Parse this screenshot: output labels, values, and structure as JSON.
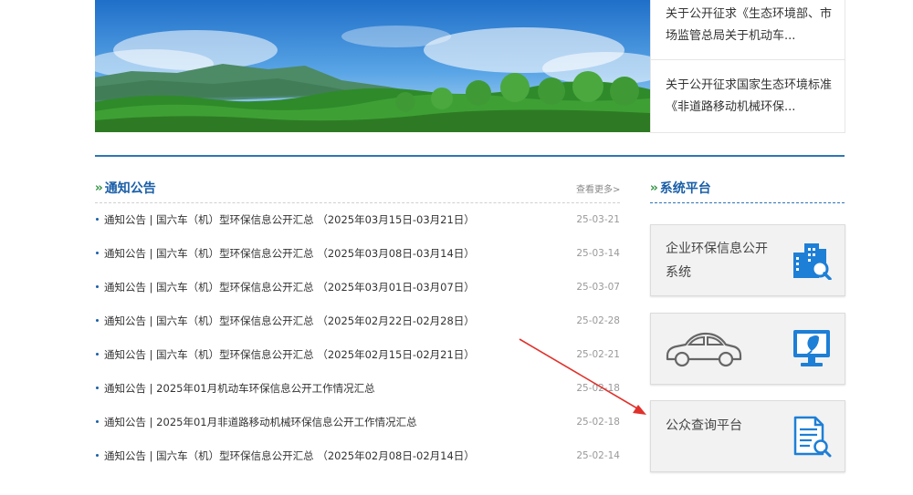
{
  "banner": {
    "news": [
      {
        "text": "关于公开征求《生态环境部、市场监管总局关于机动车..."
      },
      {
        "text": "关于公开征求国家生态环境标准《非道路移动机械环保..."
      }
    ]
  },
  "notice": {
    "title": "通知公告",
    "more": "查看更多>",
    "items": [
      {
        "title": "通知公告 | 国六车（机）型环保信息公开汇总 （2025年03月15日-03月21日）",
        "date": "25-03-21"
      },
      {
        "title": "通知公告 | 国六车（机）型环保信息公开汇总 （2025年03月08日-03月14日）",
        "date": "25-03-14"
      },
      {
        "title": "通知公告 | 国六车（机）型环保信息公开汇总 （2025年03月01日-03月07日）",
        "date": "25-03-07"
      },
      {
        "title": "通知公告 | 国六车（机）型环保信息公开汇总 （2025年02月22日-02月28日）",
        "date": "25-02-28"
      },
      {
        "title": "通知公告 | 国六车（机）型环保信息公开汇总 （2025年02月15日-02月21日）",
        "date": "25-02-21"
      },
      {
        "title": "通知公告 | 2025年01月机动车环保信息公开工作情况汇总",
        "date": "25-02-18"
      },
      {
        "title": "通知公告 | 2025年01月非道路移动机械环保信息公开工作情况汇总",
        "date": "25-02-18"
      },
      {
        "title": "通知公告 | 国六车（机）型环保信息公开汇总 （2025年02月08日-02月14日）",
        "date": "25-02-14"
      }
    ]
  },
  "platform": {
    "title": "系统平台",
    "cards": [
      {
        "label": "企业环保信息公开系统",
        "icon": "building-search-icon"
      },
      {
        "label": "",
        "icon": "monitor-leaf-icon",
        "left_icon": "car-icon"
      },
      {
        "label": "公众查询平台",
        "icon": "document-search-icon"
      }
    ]
  },
  "colors": {
    "accent_blue": "#1a5fa8",
    "rule_blue": "#2e75b6",
    "icon_blue": "#1e7fd6",
    "chevron_green": "#2a8f3d",
    "annotation_red": "#e0312b"
  }
}
